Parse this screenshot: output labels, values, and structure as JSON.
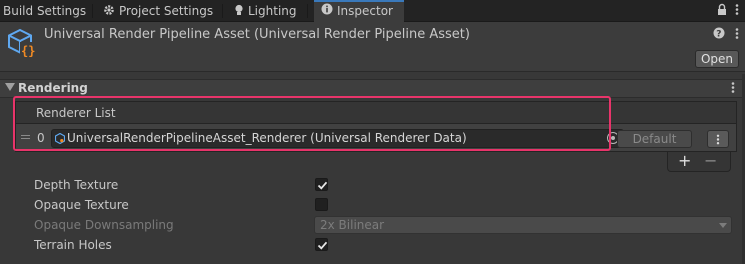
{
  "tabs": [
    {
      "label": "Build Settings",
      "icon": "none"
    },
    {
      "label": "Project Settings",
      "icon": "gear-icon"
    },
    {
      "label": "Lighting",
      "icon": "lightbulb-icon"
    },
    {
      "label": "Inspector",
      "icon": "info-icon",
      "active": true
    }
  ],
  "header": {
    "title": "Universal Render Pipeline Asset (Universal Render Pipeline Asset)",
    "open_label": "Open"
  },
  "section": {
    "title": "Rendering",
    "renderer_list": {
      "header": "Renderer List",
      "items": [
        {
          "index": "0",
          "value": "UniversalRenderPipelineAsset_Renderer (Universal Renderer Data)",
          "default_label": "Default"
        }
      ],
      "add_label": "+",
      "remove_label": "−"
    },
    "properties": [
      {
        "label": "Depth Texture",
        "type": "toggle",
        "checked": true,
        "disabled": false
      },
      {
        "label": "Opaque Texture",
        "type": "toggle",
        "checked": false,
        "disabled": false
      },
      {
        "label": "Opaque Downsampling",
        "type": "dropdown",
        "value": "2x Bilinear",
        "disabled": true
      },
      {
        "label": "Terrain Holes",
        "type": "toggle",
        "checked": true,
        "disabled": false
      }
    ]
  },
  "colors": {
    "highlight": "#e8346a",
    "active_tab_accent": "#3a79bb",
    "asset_icon_primary": "#5fa8f0",
    "asset_icon_brace": "#f08a24"
  }
}
